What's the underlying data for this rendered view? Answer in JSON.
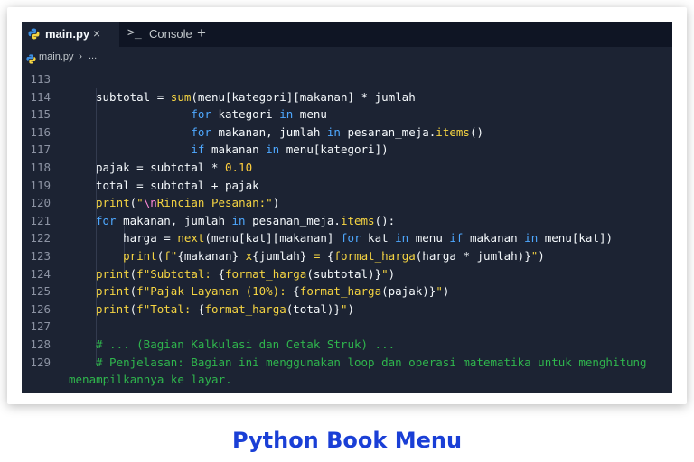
{
  "tabs": [
    {
      "label": "main.py",
      "close": "×"
    },
    {
      "label": "Console",
      "prompt": ">_"
    }
  ],
  "add_tab": "+",
  "breadcrumb": {
    "file": "main.py",
    "separator": "›",
    "more": "..."
  },
  "lines": [
    {
      "no": "113",
      "parts": []
    },
    {
      "no": "114",
      "parts": [
        [
          "",
          "subtotal = "
        ],
        [
          "f",
          "sum"
        ],
        [
          "",
          "(menu[kategori][makanan] * jumlah"
        ]
      ]
    },
    {
      "no": "115",
      "parts": [
        [
          "",
          "              "
        ],
        [
          "k",
          "for"
        ],
        [
          "",
          " kategori "
        ],
        [
          "k",
          "in"
        ],
        [
          "",
          " menu"
        ]
      ]
    },
    {
      "no": "116",
      "parts": [
        [
          "",
          "              "
        ],
        [
          "k",
          "for"
        ],
        [
          "",
          " makanan, jumlah "
        ],
        [
          "k",
          "in"
        ],
        [
          "",
          " pesanan_meja."
        ],
        [
          "f",
          "items"
        ],
        [
          "",
          "()"
        ]
      ]
    },
    {
      "no": "117",
      "parts": [
        [
          "",
          "              "
        ],
        [
          "k",
          "if"
        ],
        [
          "",
          " makanan "
        ],
        [
          "k",
          "in"
        ],
        [
          "",
          " menu[kategori])"
        ]
      ]
    },
    {
      "no": "118",
      "parts": [
        [
          "",
          "pajak = subtotal * "
        ],
        [
          "n",
          "0.10"
        ]
      ]
    },
    {
      "no": "119",
      "parts": [
        [
          "",
          "total = subtotal + pajak"
        ]
      ]
    },
    {
      "no": "120",
      "parts": [
        [
          "f",
          "print"
        ],
        [
          "",
          "("
        ],
        [
          "s",
          "\""
        ],
        [
          "esc",
          "\\n"
        ],
        [
          "s",
          "Rincian Pesanan:\""
        ],
        [
          "",
          ")"
        ]
      ]
    },
    {
      "no": "121",
      "parts": [
        [
          "k",
          "for"
        ],
        [
          "",
          " makanan, jumlah "
        ],
        [
          "k",
          "in"
        ],
        [
          "",
          " pesanan_meja."
        ],
        [
          "f",
          "items"
        ],
        [
          "",
          "():"
        ]
      ]
    },
    {
      "no": "122",
      "parts": [
        [
          "",
          "    harga = "
        ],
        [
          "f",
          "next"
        ],
        [
          "",
          "(menu[kat][makanan] "
        ],
        [
          "k",
          "for"
        ],
        [
          "",
          " kat "
        ],
        [
          "k",
          "in"
        ],
        [
          "",
          " menu "
        ],
        [
          "k",
          "if"
        ],
        [
          "",
          " makanan "
        ],
        [
          "k",
          "in"
        ],
        [
          "",
          " menu[kat])"
        ]
      ]
    },
    {
      "no": "123",
      "parts": [
        [
          "",
          "    "
        ],
        [
          "f",
          "print"
        ],
        [
          "",
          "("
        ],
        [
          "s",
          "f\""
        ],
        [
          "",
          "{makanan} "
        ],
        [
          "s",
          "x"
        ],
        [
          "",
          "{jumlah} "
        ],
        [
          "s",
          "= "
        ],
        [
          "",
          "{"
        ],
        [
          "f",
          "format_harga"
        ],
        [
          "",
          "(harga * jumlah)}"
        ],
        [
          "s",
          "\""
        ],
        [
          "",
          ")"
        ]
      ]
    },
    {
      "no": "124",
      "parts": [
        [
          "f",
          "print"
        ],
        [
          "",
          "("
        ],
        [
          "s",
          "f\"Subtotal: "
        ],
        [
          "",
          "{"
        ],
        [
          "f",
          "format_harga"
        ],
        [
          "",
          "(subtotal)}"
        ],
        [
          "s",
          "\""
        ],
        [
          "",
          ")"
        ]
      ]
    },
    {
      "no": "125",
      "parts": [
        [
          "f",
          "print"
        ],
        [
          "",
          "("
        ],
        [
          "s",
          "f\"Pajak Layanan (10%): "
        ],
        [
          "",
          "{"
        ],
        [
          "f",
          "format_harga"
        ],
        [
          "",
          "(pajak)}"
        ],
        [
          "s",
          "\""
        ],
        [
          "",
          ")"
        ]
      ]
    },
    {
      "no": "126",
      "parts": [
        [
          "f",
          "print"
        ],
        [
          "",
          "("
        ],
        [
          "s",
          "f\"Total: "
        ],
        [
          "",
          "{"
        ],
        [
          "f",
          "format_harga"
        ],
        [
          "",
          "(total)}"
        ],
        [
          "s",
          "\""
        ],
        [
          "",
          ")"
        ]
      ]
    },
    {
      "no": "127",
      "parts": []
    },
    {
      "no": "128",
      "parts": [
        [
          "c",
          "# ... (Bagian Kalkulasi dan Cetak Struk) ..."
        ]
      ]
    },
    {
      "no": "129",
      "parts": [
        [
          "c",
          "# Penjelasan: Bagian ini menggunakan loop dan operasi matematika untuk menghitung"
        ]
      ]
    },
    {
      "no": "",
      "parts": [
        [
          "c",
          "menampilkannya ke layar."
        ]
      ],
      "wrap": true
    }
  ],
  "caption": "Python Book Menu",
  "colors": {
    "editor_bg": "#1c2333",
    "tabbar_bg": "#0f1524",
    "keyword": "#4ea8ff",
    "function": "#f5d442",
    "comment": "#2fb64d",
    "caption": "#1a3fd6"
  }
}
